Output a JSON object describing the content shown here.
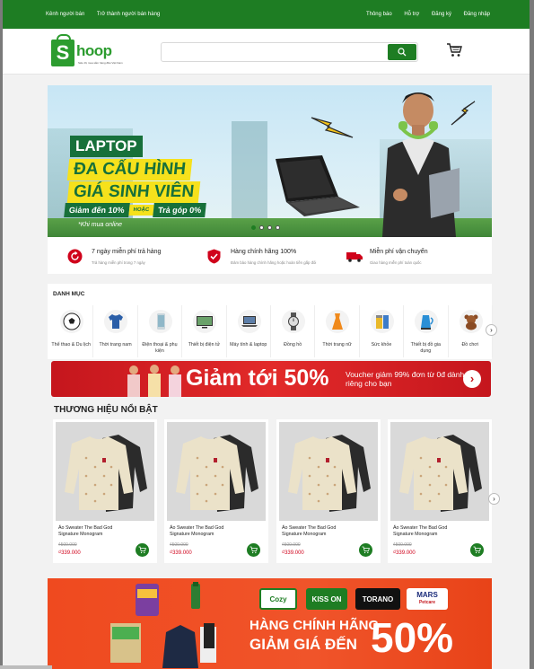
{
  "topbar": {
    "left": [
      "Kênh người bán",
      "Trở thành người bán hàng"
    ],
    "right": [
      "Thông báo",
      "Hỗ trợ",
      "Đăng ký",
      "Đăng nhập"
    ]
  },
  "header": {
    "logo_letter": "S",
    "logo_text": "hoop",
    "logo_tagline": "Siêu thị mua sắm hàng đầu Việt Nam",
    "search_placeholder": "",
    "cart_icon": "cart-icon"
  },
  "hero": {
    "badge": "LAPTOP",
    "line1": "ĐA CẤU HÌNH",
    "line2": "GIÁ SINH VIÊN",
    "promo_a": "Giảm đến 10%",
    "promo_or": "HOẶC",
    "promo_b": "Trả góp 0%",
    "note": "*Khi mua online",
    "slides": 4,
    "active_slide": 1
  },
  "services": [
    {
      "icon": "return-icon",
      "title": "7 ngày miễn phí trả hàng",
      "sub": "Trả hàng miễn phí trong 7 ngày"
    },
    {
      "icon": "shield-check-icon",
      "title": "Hàng chính hãng 100%",
      "sub": "Đảm bảo hàng chính hãng hoặc hoàn tiền gấp đôi"
    },
    {
      "icon": "truck-icon",
      "title": "Miễn phí vận chuyển",
      "sub": "Giao hàng miễn phí toàn quốc"
    }
  ],
  "categories": {
    "title": "DANH MỤC",
    "items": [
      {
        "label": "Thể thao & Du lịch",
        "icon": "ball-icon"
      },
      {
        "label": "Thời trang nam",
        "icon": "shirt-icon"
      },
      {
        "label": "Điện thoại & phụ kiện",
        "icon": "phone-icon"
      },
      {
        "label": "Thiết bị điện tử",
        "icon": "tv-icon"
      },
      {
        "label": "Máy tính & laptop",
        "icon": "laptop-icon"
      },
      {
        "label": "Đồng hồ",
        "icon": "watch-icon"
      },
      {
        "label": "Thời trang nữ",
        "icon": "dress-icon"
      },
      {
        "label": "Sức khỏe",
        "icon": "health-icon"
      },
      {
        "label": "Thiết bị đồ gia dụng",
        "icon": "kettle-icon"
      },
      {
        "label": "Đồ chơi",
        "icon": "teddy-icon"
      }
    ]
  },
  "promo": {
    "big": "Giảm tới 50%",
    "text": "Voucher giảm 99% đơn từ 0đ dành riêng cho bạn"
  },
  "brands": {
    "title": "THƯƠNG HIỆU NỔI BẬT",
    "products": [
      {
        "name": "Áo Sweater The Bad God Signature Monogram",
        "old_price": "₫500.000",
        "price": "₫339.000"
      },
      {
        "name": "Áo Sweater The Bad God Signature Monogram",
        "old_price": "₫500.000",
        "price": "₫339.000"
      },
      {
        "name": "Áo Sweater The Bad God Signature Monogram",
        "old_price": "₫500.000",
        "price": "₫339.000"
      },
      {
        "name": "Áo Sweater The Bad God Signature Monogram",
        "old_price": "₫500.000",
        "price": "₫339.000"
      }
    ]
  },
  "banner2": {
    "logos": [
      "Cozy",
      "KISS ON",
      "TORANO",
      "MARS"
    ],
    "logo_sub": "Petcare",
    "line1": "HÀNG CHÍNH HÃNG",
    "line2": "GIẢM GIÁ ĐẾN",
    "pct": "50%"
  },
  "colors": {
    "primary_green": "#1e7d23",
    "promo_red": "#c5161d",
    "price_red": "#d0021b",
    "banner_orange": "#ef4a1f"
  }
}
